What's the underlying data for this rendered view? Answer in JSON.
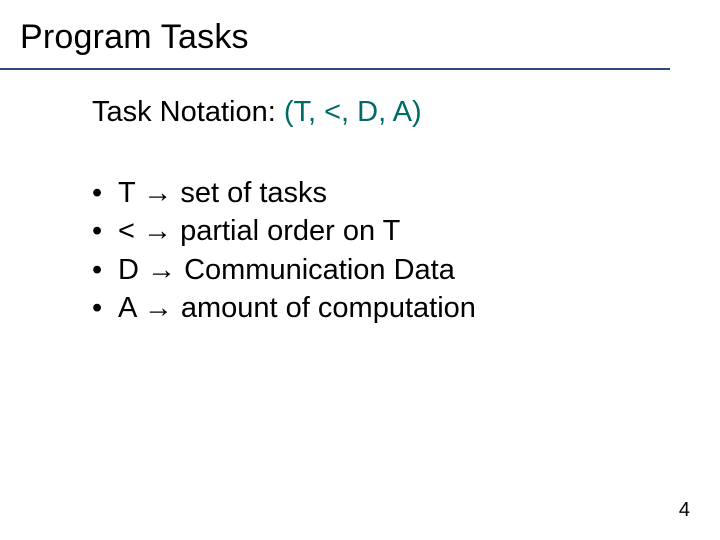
{
  "title": "Program Tasks",
  "notation": {
    "label": "Task Notation:  ",
    "tuple": "(T, <, D, A)"
  },
  "bullets": {
    "items": [
      {
        "sym": "T",
        "desc": "set of tasks"
      },
      {
        "sym": "<",
        "desc": "partial order on T"
      },
      {
        "sym": "D",
        "desc": "Communication Data"
      },
      {
        "sym": "A",
        "desc": "amount of computation"
      }
    ]
  },
  "glyphs": {
    "bullet": "•",
    "arrow": "→"
  },
  "page": "4"
}
